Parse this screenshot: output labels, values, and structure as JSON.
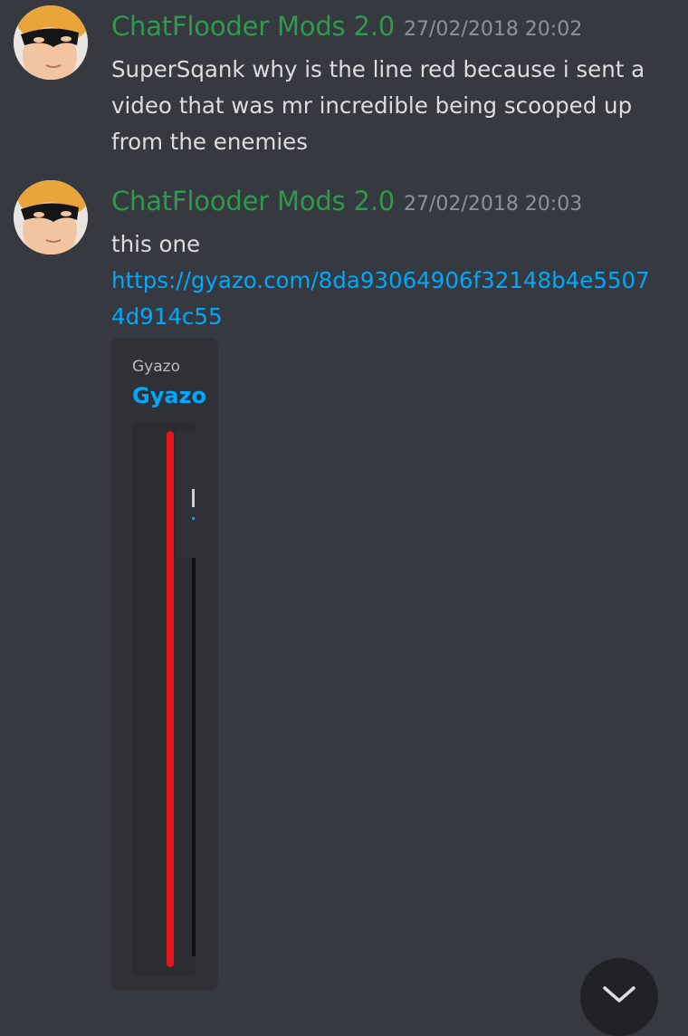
{
  "messages": [
    {
      "author": "ChatFlooder Mods 2.0",
      "timestamp": "27/02/2018 20:02",
      "text": "SuperSqank why is the line red because i sent a video that was mr incredible being scooped up from the enemies"
    },
    {
      "author": "ChatFlooder Mods 2.0",
      "timestamp": "27/02/2018 20:03",
      "text": "this one",
      "link": "https://gyazo.com/8da93064906f32148b4e55074d914c55",
      "embed": {
        "provider": "Gyazo",
        "title": "Gyazo"
      }
    }
  ],
  "colors": {
    "background": "#36393f",
    "author": "#2e9a4b",
    "link": "#00a8fc",
    "embed_background": "#2f3136",
    "red_line": "#e5171b"
  },
  "icons": {
    "avatar": "avatar",
    "scroll_to_bottom": "chevron-down-icon"
  }
}
